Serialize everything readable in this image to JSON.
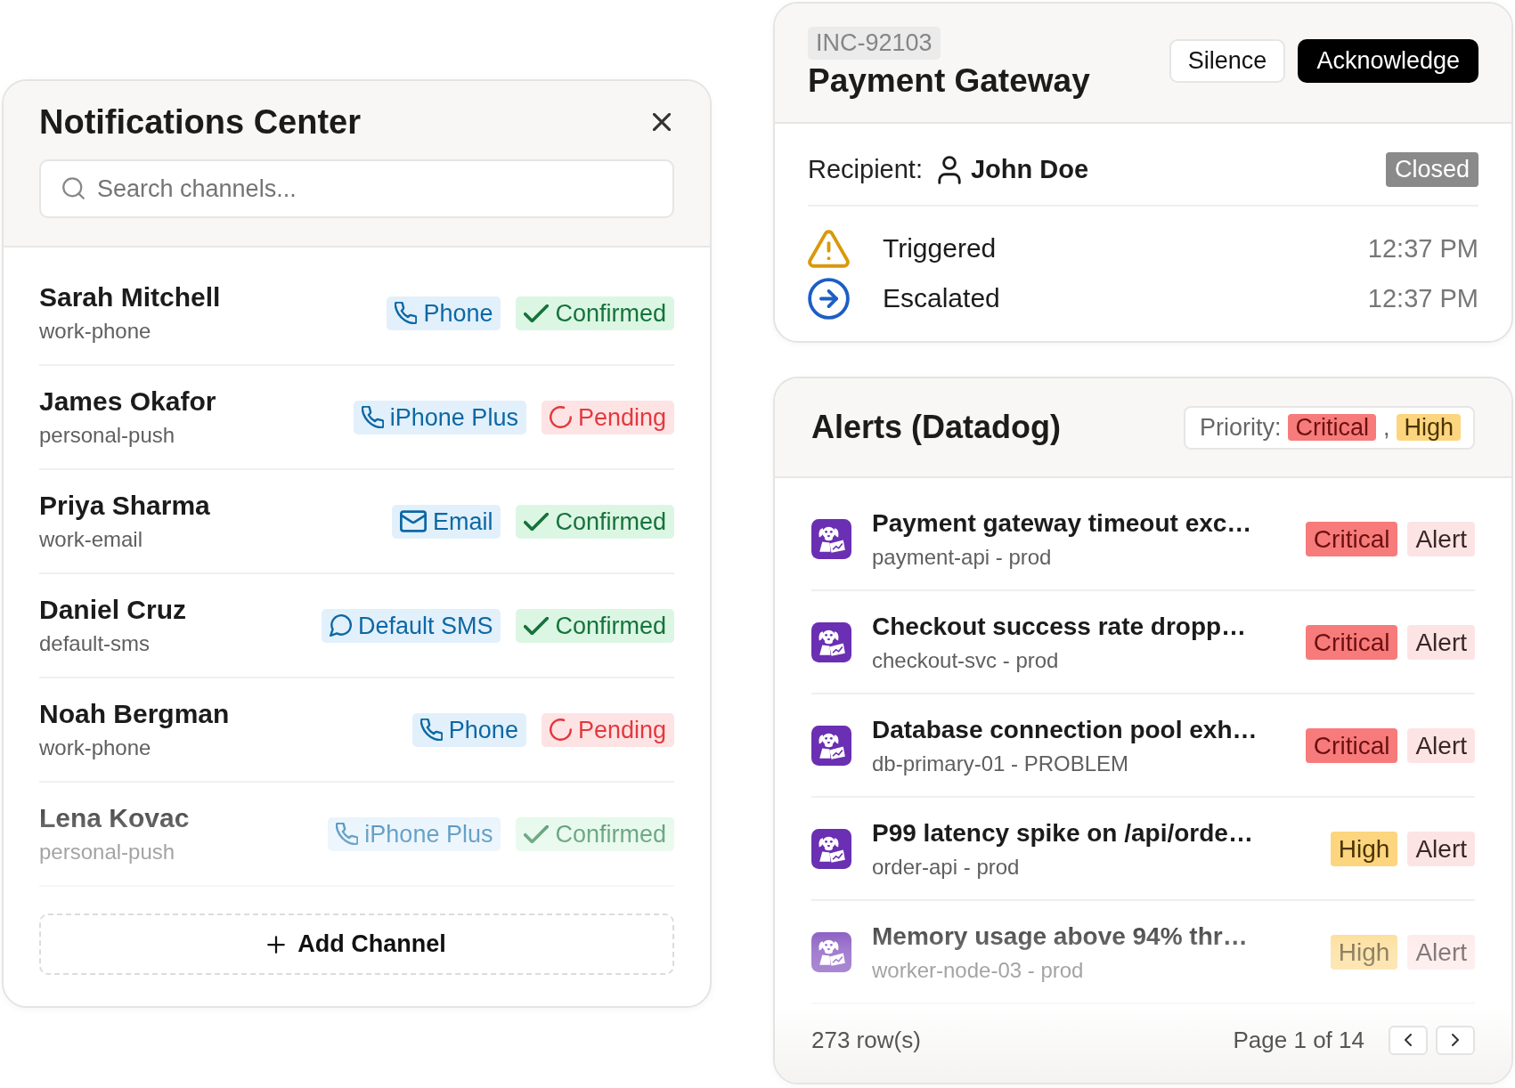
{
  "notifications_panel": {
    "title": "Notifications Center",
    "search": {
      "placeholder": "Search channels..."
    },
    "channels": [
      {
        "name": "Sarah Mitchell",
        "handle": "work-phone",
        "channel": {
          "kind": "phone",
          "label": "Phone"
        },
        "status": {
          "kind": "confirmed",
          "label": "Confirmed"
        }
      },
      {
        "name": "James Okafor",
        "handle": "personal-push",
        "channel": {
          "kind": "phone",
          "label": "iPhone Plus"
        },
        "status": {
          "kind": "pending",
          "label": "Pending"
        }
      },
      {
        "name": "Priya Sharma",
        "handle": "work-email",
        "channel": {
          "kind": "email",
          "label": "Email"
        },
        "status": {
          "kind": "confirmed",
          "label": "Confirmed"
        }
      },
      {
        "name": "Daniel Cruz",
        "handle": "default-sms",
        "channel": {
          "kind": "sms",
          "label": "Default SMS"
        },
        "status": {
          "kind": "confirmed",
          "label": "Confirmed"
        }
      },
      {
        "name": "Noah Bergman",
        "handle": "work-phone",
        "channel": {
          "kind": "phone",
          "label": "Phone"
        },
        "status": {
          "kind": "pending",
          "label": "Pending"
        }
      },
      {
        "name": "Lena Kovac",
        "handle": "personal-push",
        "channel": {
          "kind": "phone",
          "label": "iPhone Plus"
        },
        "status": {
          "kind": "confirmed",
          "label": "Confirmed"
        }
      }
    ],
    "add_button": "Add Channel"
  },
  "incident": {
    "id": "INC-92103",
    "title": "Payment Gateway",
    "buttons": [
      {
        "label": "Silence",
        "kind": "secondary"
      },
      {
        "label": "Acknowledge",
        "kind": "primary"
      }
    ],
    "recipient_label": "Recipient:",
    "recipient": "John Doe",
    "status": "Closed",
    "events": [
      {
        "kind": "triggered",
        "label": "Triggered",
        "time": "12:37 PM"
      },
      {
        "kind": "escalated",
        "label": "Escalated",
        "time": "12:37 PM"
      }
    ]
  },
  "alerts": {
    "title": "Alerts (Datadog)",
    "priority_filter": {
      "label": "Priority:",
      "values": [
        {
          "kind": "critical",
          "label": "Critical"
        },
        {
          "kind": "high",
          "label": "High"
        }
      ],
      "separator": ","
    },
    "rows": [
      {
        "title": "Payment gateway timeout exc…",
        "source": "payment-api - prod",
        "priority": {
          "kind": "critical",
          "label": "Critical"
        },
        "type": "Alert"
      },
      {
        "title": "Checkout success rate dropp…",
        "source": "checkout-svc - prod",
        "priority": {
          "kind": "critical",
          "label": "Critical"
        },
        "type": "Alert"
      },
      {
        "title": "Database connection pool exh…",
        "source": "db-primary-01 - PROBLEM",
        "priority": {
          "kind": "critical",
          "label": "Critical"
        },
        "type": "Alert"
      },
      {
        "title": "P99 latency spike on /api/orde…",
        "source": "order-api - prod",
        "priority": {
          "kind": "high",
          "label": "High"
        },
        "type": "Alert"
      },
      {
        "title": "Memory usage above 94% thr…",
        "source": "worker-node-03 - prod",
        "priority": {
          "kind": "high",
          "label": "High"
        },
        "type": "Alert"
      }
    ],
    "footer": {
      "row_count": "273 row(s)",
      "page": "Page 1 of 14"
    }
  }
}
